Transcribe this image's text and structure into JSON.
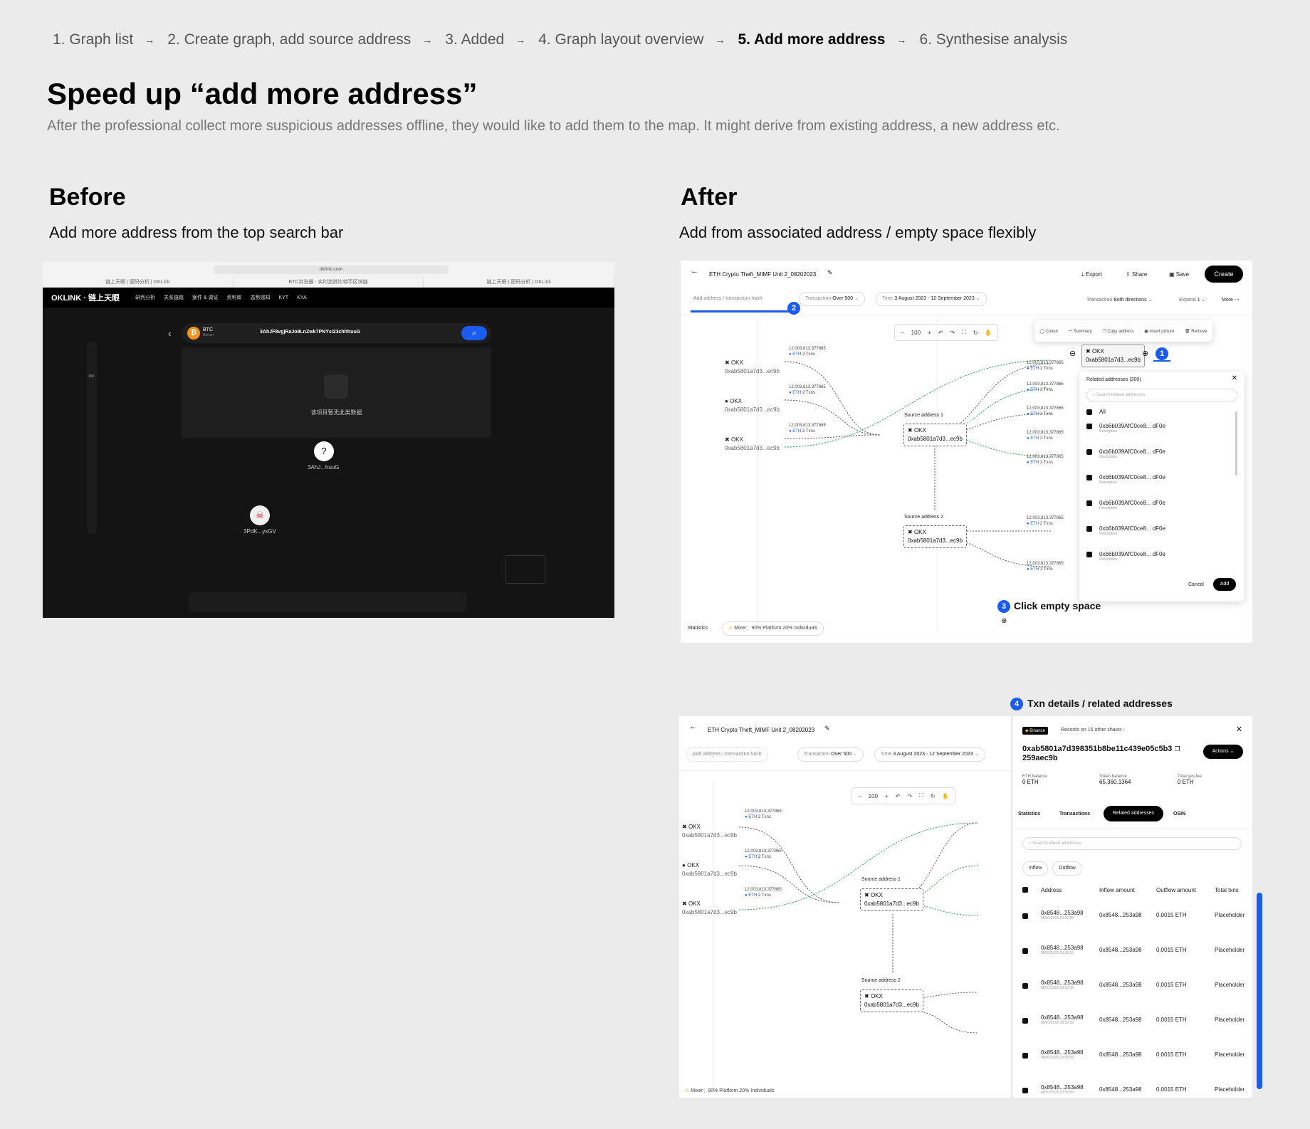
{
  "steps": [
    {
      "label": "1. Graph list"
    },
    {
      "label": "2. Create graph, add source address"
    },
    {
      "label": "3. Added"
    },
    {
      "label": "4. Graph layout overview"
    },
    {
      "label": "5. Add more address",
      "active": true
    },
    {
      "label": "6. Synthesise analysis"
    }
  ],
  "step_arrow": "→",
  "title": "Speed up “add more address”",
  "subtitle": "After the professional collect more suspicious addresses offline, they would like to add them to the map. It might derive from existing address, a new address etc.",
  "before": {
    "heading": "Before",
    "desc": "Add more address from the top search bar",
    "url": "oklink.com",
    "tabs": [
      "链上天眼 | 密码分析 | OKLink",
      "BTC浏览器 - 实时追踪比特币区块链",
      "链上天眼 | 密码分析 | OKLink"
    ],
    "logo": "OKLINK · 链上天眼",
    "nav": [
      "研判分析",
      "关系链路",
      "案件 & 调证",
      "资料库",
      "态势感知",
      "KYT",
      "KYA"
    ],
    "coin": "BTC",
    "coin_sub": "Bitcoin",
    "search_value": "3AhJF8vgjRaJo9LnZwk7PNYsi23chhhuuG",
    "no_data": "该项目暂无此类数据",
    "node1_label": "3AhJ...huuG",
    "node2_label": "3PdK...yxGV",
    "zoom": "150"
  },
  "after": {
    "heading": "After",
    "desc": "Add from associated address / empty space flexibly",
    "graph_title": "ETH Crypto Theft_MIMF Unit 2_08202023",
    "export": "Export",
    "share": "Share",
    "save": "Save",
    "create": "Create",
    "add_placeholder": "Add address / transaction hash",
    "transaction_label": "Transaction",
    "transaction_value": "Over 500",
    "time_label": "Time",
    "time_value": "3 August 2023 - 12 September 2023",
    "transaction_dir_label": "Transaction",
    "transaction_dir_value": "Both directions",
    "expand_label": "Expand",
    "expand_value": "1",
    "more": "More",
    "zoom": "100",
    "node_name": "OKX",
    "node_addr": "0xab5801a7d3...ec9b",
    "edge_amount": "12,003,813.377865",
    "edge_unit": "ETH",
    "edge_txns": "2 Txns",
    "source1": "Source address 1",
    "source2": "Source address 2",
    "context_menu": [
      "Colour",
      "Summary",
      "Copy address",
      "Insert picture",
      "Remove"
    ],
    "related_title": "Related addresses (200)",
    "related_search": "Search related addresses",
    "all": "All",
    "related_items": [
      {
        "addr": "0xb6b039AfC0ce8... dF0e",
        "desc": "Description"
      },
      {
        "addr": "0xb6b039AfC0ce8... dF0e",
        "desc": "Description"
      },
      {
        "addr": "0xb6b039AfC0ce8... dF0e",
        "desc": "Description"
      },
      {
        "addr": "0xb6b039AfC0ce8... dF0e",
        "desc": "Description"
      },
      {
        "addr": "0xb6b039AfC0ce8... dF0e",
        "desc": "Description"
      },
      {
        "addr": "0xb6b039AfC0ce8... dF0e",
        "desc": "Description"
      }
    ],
    "cancel": "Cancel",
    "add": "Add",
    "callout3": "Click empty space",
    "statistics": "Statistics",
    "mixer": "Mixer：90% Platform 20% Individuals",
    "badges": [
      "1",
      "2",
      "3",
      "4"
    ]
  },
  "details": {
    "callout4": "Txn details / related addresses",
    "exchange": "Binance",
    "records": "Records on 15 other chains",
    "address_line1": "0xab5801a7d398351b8be11c439e05c5b3",
    "address_line2": "259aec9b",
    "actions": "Actions",
    "stats": [
      {
        "label": "ETH balance",
        "value": "0 ETH"
      },
      {
        "label": "Token balance",
        "value": "65,360.1364"
      },
      {
        "label": "Total gas fee",
        "value": "0 ETH"
      }
    ],
    "tabs": [
      "Statistics",
      "Transactions",
      "Related addresses",
      "OSIN"
    ],
    "search": "Search related addresses",
    "filters": [
      "Inflow",
      "Outflow"
    ],
    "columns": [
      "Address",
      "Inflow amount",
      "Outflow amount",
      "Total txns"
    ],
    "rows": [
      {
        "addr": "0x8548...253a98",
        "date": "08/01/2023 23:59:59",
        "inflow": "0x8548...253a98",
        "outflow": "0.0015 ETH",
        "txns": "Placeholder"
      },
      {
        "addr": "0x8548...253a98",
        "date": "08/01/2023 23:59:59",
        "inflow": "0x8548...253a98",
        "outflow": "0.0015 ETH",
        "txns": "Placeholder"
      },
      {
        "addr": "0x8548...253a98",
        "date": "08/01/2023 23:59:59",
        "inflow": "0x8548...253a98",
        "outflow": "0.0015 ETH",
        "txns": "Placeholder"
      },
      {
        "addr": "0x8548...253a98",
        "date": "08/01/2023 23:59:59",
        "inflow": "0x8548...253a98",
        "outflow": "0.0015 ETH",
        "txns": "Placeholder"
      },
      {
        "addr": "0x8548...253a98",
        "date": "08/01/2023 23:59:59",
        "inflow": "0x8548...253a98",
        "outflow": "0.0015 ETH",
        "txns": "Placeholder"
      },
      {
        "addr": "0x8548...253a98",
        "date": "08/01/2023 23:59:59",
        "inflow": "0x8548...253a98",
        "outflow": "0.0015 ETH",
        "txns": "Placeholder"
      }
    ]
  },
  "colors": {
    "accent": "#1a5cf0",
    "background": "#ebebeb",
    "dark": "#141414"
  }
}
